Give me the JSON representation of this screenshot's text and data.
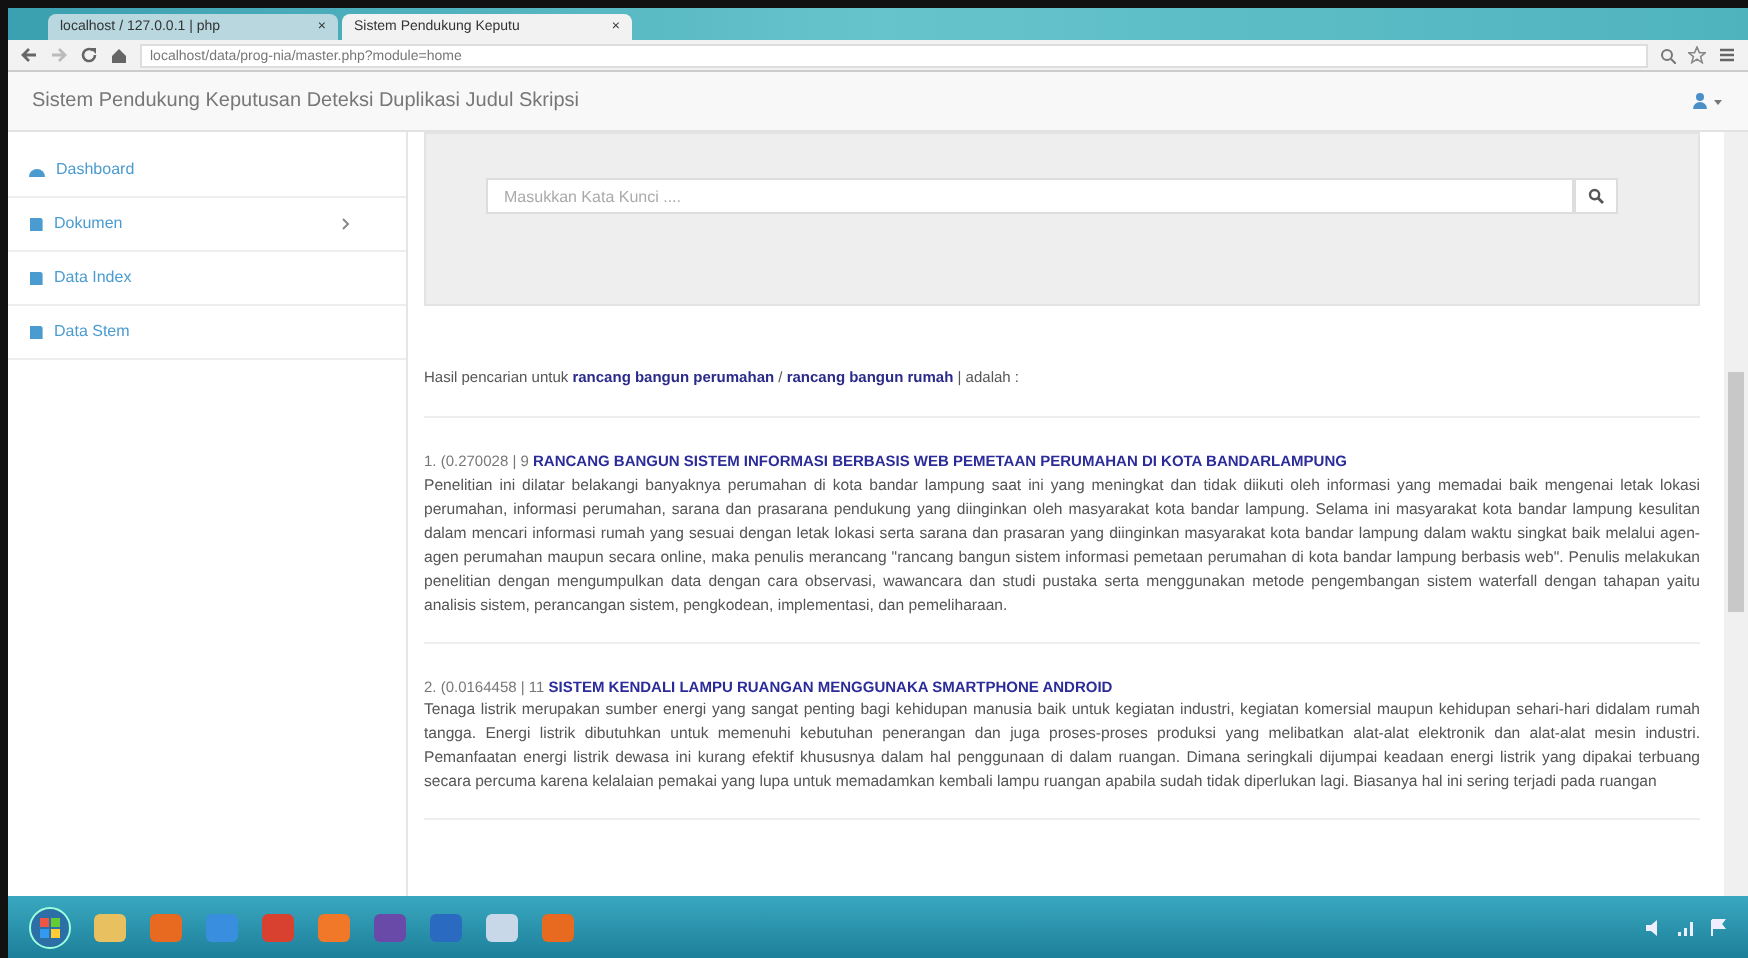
{
  "browser": {
    "tabs": [
      {
        "label": "localhost / 127.0.0.1 | php",
        "selected": false
      },
      {
        "label": "Sistem Pendukung Keputu",
        "selected": true
      }
    ],
    "close_glyph": "×",
    "address": "localhost/data/prog-nia/master.php?module=home"
  },
  "navbar": {
    "brand": "Sistem Pendukung Keputusan Deteksi Duplikasi Judul Skripsi"
  },
  "sidebar": {
    "items": [
      {
        "label": "Dashboard",
        "kind": "home",
        "submenu": false
      },
      {
        "label": "Dokumen",
        "kind": "book",
        "submenu": true
      },
      {
        "label": "Data Index",
        "kind": "book",
        "submenu": false
      },
      {
        "label": "Data Stem",
        "kind": "book",
        "submenu": false
      }
    ]
  },
  "search": {
    "placeholder": "Masukkan Kata Kunci ...."
  },
  "summary": "Hasil pencarian untuk **rancang bangun perumahan** / **rancang bangun rumah** | adalah :",
  "results": [
    {
      "index": "1. (0.270028 | 9",
      "title": "RANCANG BANGUN SISTEM INFORMASI BERBASIS WEB PEMETAAN PERUMAHAN DI KOTA BANDARLAMPUNG",
      "abstract": "Penelitian ini dilatar belakangi banyaknya perumahan di kota bandar lampung saat ini yang meningkat dan tidak diikuti oleh informasi yang memadai baik mengenai letak lokasi perumahan, informasi perumahan, sarana dan prasarana pendukung yang diinginkan oleh masyarakat kota bandar lampung. Selama ini masyarakat kota bandar lampung kesulitan dalam mencari informasi rumah yang sesuai dengan letak lokasi serta sarana dan prasaran yang diinginkan masyarakat kota bandar lampung dalam waktu singkat baik melalui agen-agen perumahan maupun secara online, maka penulis merancang \"rancang bangun sistem informasi pemetaan perumahan di kota bandar lampung berbasis web\". Penulis melakukan penelitian dengan mengumpulkan data dengan cara observasi, wawancara dan studi pustaka serta menggunakan metode pengembangan sistem waterfall dengan tahapan yaitu analisis sistem, perancangan sistem, pengkodean, implementasi, dan pemeliharaan."
    },
    {
      "index": "2. (0.0164458 | 11",
      "title": "SISTEM KENDALI LAMPU RUANGAN MENGGUNAKA SMARTPHONE ANDROID",
      "abstract": "Tenaga listrik merupakan sumber energi yang sangat penting bagi kehidupan manusia baik untuk kegiatan industri, kegiatan komersial maupun kehidupan sehari-hari didalam rumah tangga. Energi listrik dibutuhkan untuk memenuhi kebutuhan penerangan dan juga proses-proses produksi yang melibatkan alat-alat elektronik dan alat-alat mesin industri. Pemanfaatan energi listrik dewasa ini kurang efektif khususnya dalam hal penggunaan di dalam ruangan. Dimana seringkali dijumpai keadaan energi listrik yang dipakai terbuang secara percuma karena kelalaian pemakai yang lupa untuk memadamkan kembali lampu ruangan apabila sudah tidak diperlukan lagi. Biasanya hal ini sering terjadi pada ruangan"
    }
  ]
}
